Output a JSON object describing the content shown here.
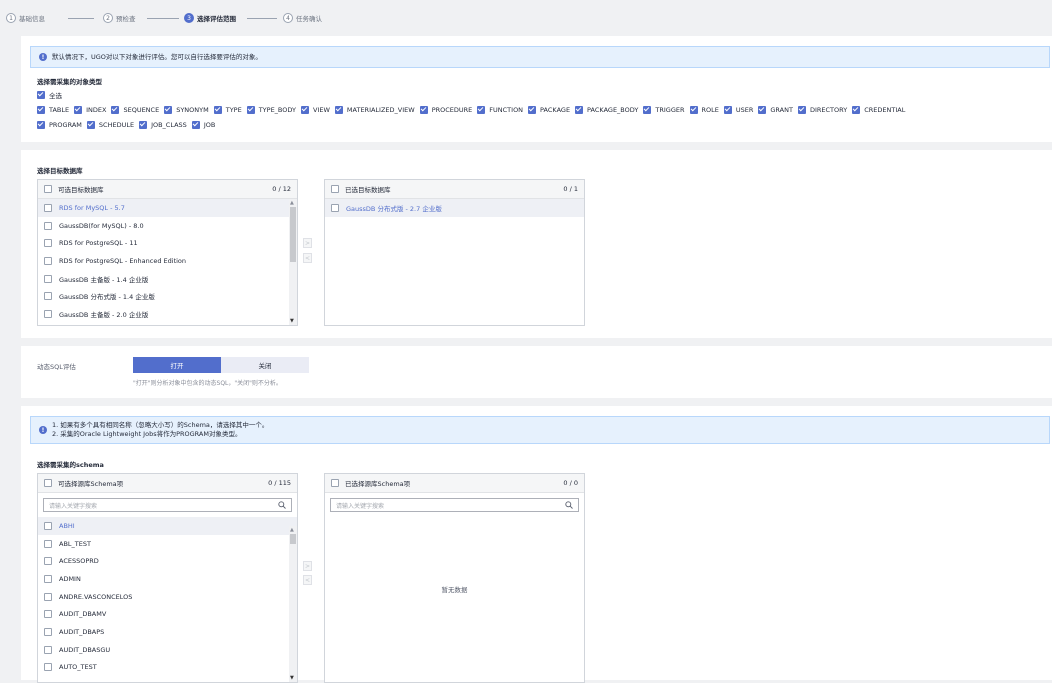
{
  "steps": [
    {
      "num": "1",
      "label": "基础信息",
      "active": false
    },
    {
      "num": "2",
      "label": "预检查",
      "active": false
    },
    {
      "num": "3",
      "label": "选择评估范围",
      "active": true
    },
    {
      "num": "4",
      "label": "任务确认",
      "active": false
    }
  ],
  "info1": {
    "text": "默认情况下，UGO对以下对象进行评估。您可以自行选择要评估的对象。"
  },
  "object_types": {
    "title": "选择需采集的对象类型",
    "select_all": "全选",
    "items": [
      "TABLE",
      "INDEX",
      "SEQUENCE",
      "SYNONYM",
      "TYPE",
      "TYPE_BODY",
      "VIEW",
      "MATERIALIZED_VIEW",
      "PROCEDURE",
      "FUNCTION",
      "PACKAGE",
      "PACKAGE_BODY",
      "TRIGGER",
      "ROLE",
      "USER",
      "GRANT",
      "DIRECTORY",
      "CREDENTIAL",
      "PROGRAM",
      "SCHEDULE",
      "JOB_CLASS",
      "JOB"
    ]
  },
  "target_db": {
    "title": "选择目标数据库",
    "available_title": "可选目标数据库",
    "available_count": "0 / 12",
    "available_items": [
      "RDS for MySQL - 5.7",
      "GaussDB(for MySQL) - 8.0",
      "RDS for PostgreSQL - 11",
      "RDS for PostgreSQL - Enhanced Edition",
      "GaussDB 主备版 - 1.4 企业版",
      "GaussDB 分布式版 - 1.4 企业版",
      "GaussDB 主备版 - 2.0 企业版"
    ],
    "selected_title": "已选目标数据库",
    "selected_count": "0 / 1",
    "selected_items": [
      "GaussDB 分布式版 - 2.7 企业版"
    ],
    "move_right": ">",
    "move_left": "<"
  },
  "dynamic_sql": {
    "label": "动态SQL评估",
    "on_label": "打开",
    "off_label": "关闭",
    "hint": "\"打开\"则分析对象中包含的动态SQL，\"关闭\"则不分析。"
  },
  "info2": {
    "line1": "1. 如果有多个具有相同名称（忽略大小写）的Schema，请选择其中一个。",
    "line2": "2. 采集的Oracle Lightweight Jobs将作为PROGRAM对象类型。"
  },
  "schema": {
    "title": "选择需采集的schema",
    "available_title": "可选择源库Schema项",
    "available_count": "0 / 115",
    "search_placeholder": "请输入关键字搜索",
    "available_items": [
      "ABHI",
      "ABL_TEST",
      "ACESSOPRD",
      "ADMIN",
      "ANDRE.VASCONCELOS",
      "AUDIT_DBAMV",
      "AUDIT_DBAPS",
      "AUDIT_DBASGU",
      "AUTO_TEST"
    ],
    "selected_title": "已选择源库Schema项",
    "selected_count": "0 / 0",
    "selected_search_placeholder": "请输入关键字搜索",
    "empty_text": "暂无数据",
    "move_right": ">",
    "move_left": "<"
  },
  "colors": {
    "accent": "#526ecc",
    "info_bg": "#e6f1fd"
  }
}
